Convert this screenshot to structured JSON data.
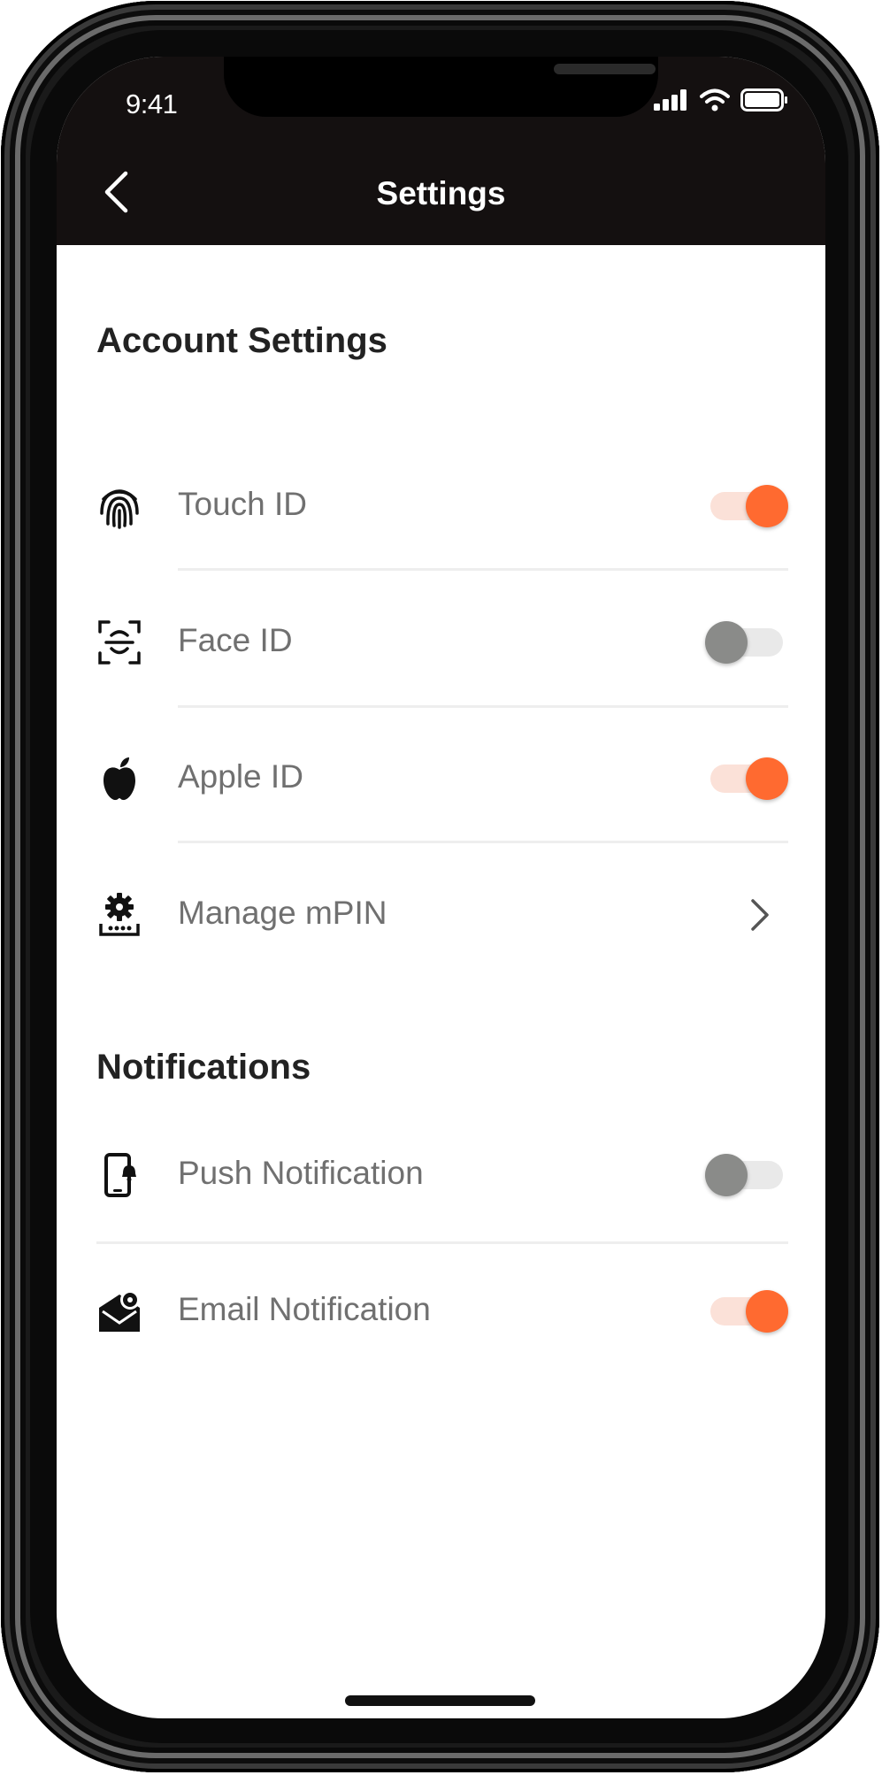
{
  "status_bar": {
    "time": "9:41"
  },
  "header": {
    "title": "Settings"
  },
  "colors": {
    "accent": "#ff6a30",
    "header_bg": "#141010",
    "toggle_off": "#8a8b89"
  },
  "sections": [
    {
      "title": "Account Settings",
      "items": [
        {
          "label": "Touch ID",
          "icon": "fingerprint-icon",
          "control": "toggle",
          "enabled": true
        },
        {
          "label": "Face ID",
          "icon": "face-id-icon",
          "control": "toggle",
          "enabled": false
        },
        {
          "label": "Apple ID",
          "icon": "apple-icon",
          "control": "toggle",
          "enabled": true
        },
        {
          "label": "Manage mPIN",
          "icon": "mpin-gear-icon",
          "control": "chevron"
        }
      ]
    },
    {
      "title": "Notifications",
      "items": [
        {
          "label": "Push Notification",
          "icon": "phone-bell-icon",
          "control": "toggle",
          "enabled": false
        },
        {
          "label": "Email Notification",
          "icon": "email-settings-icon",
          "control": "toggle",
          "enabled": true
        }
      ]
    }
  ]
}
